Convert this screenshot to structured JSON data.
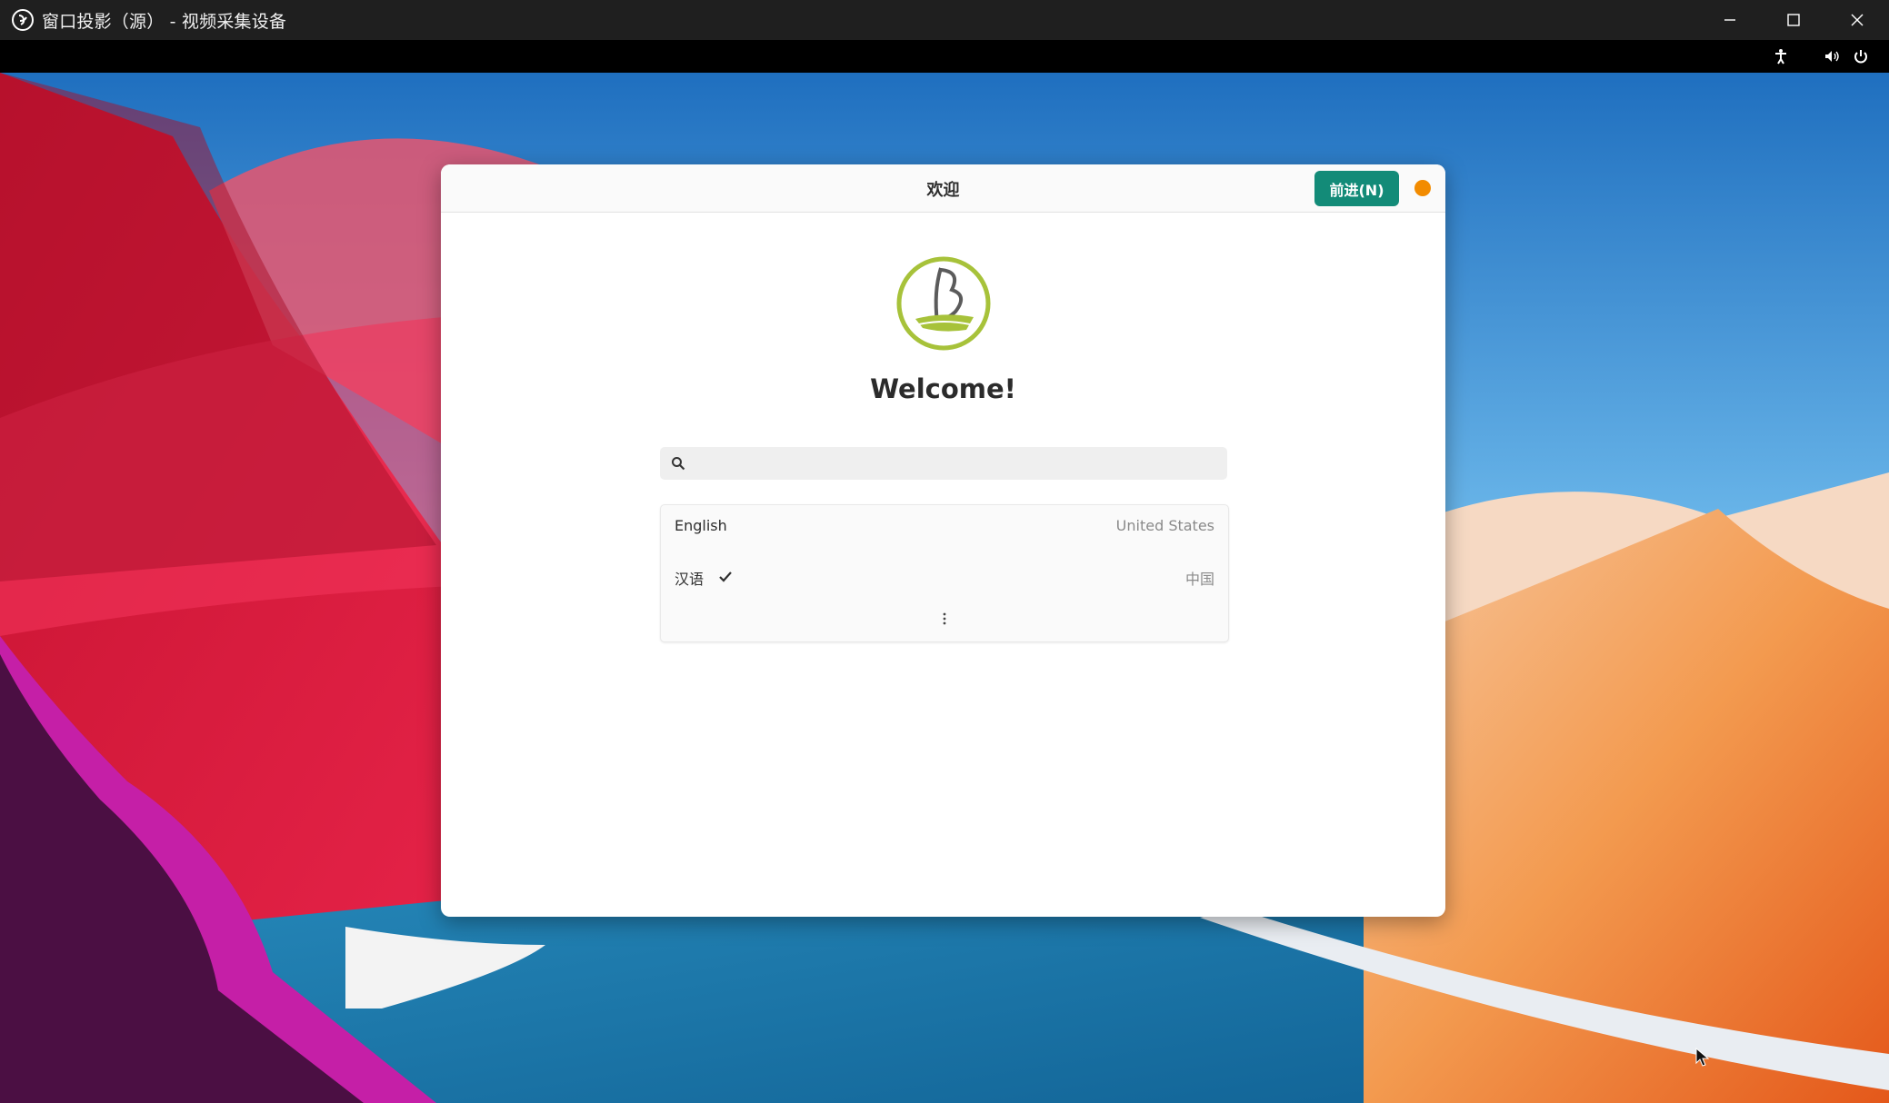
{
  "window": {
    "title": "窗口投影（源） - 视频采集设备",
    "app_icon": "obs-icon",
    "controls": [
      "minimize-icon",
      "maximize-icon",
      "close-icon"
    ]
  },
  "guest_topbar": {
    "icons": [
      "accessibility-icon",
      "volume-icon",
      "power-icon"
    ]
  },
  "dialog": {
    "title": "欢迎",
    "next_button": "前进(N)",
    "status_dot_color": "#f28b00",
    "heading": "Welcome!",
    "search": {
      "placeholder": "",
      "value": ""
    },
    "languages": [
      {
        "name": "English",
        "region": "United States",
        "selected": false
      },
      {
        "name": "汉语",
        "region": "中国",
        "selected": true
      }
    ],
    "more_icon": "more-vertical-icon"
  },
  "colors": {
    "accent": "#138b78",
    "titlebar": "#1f1f1f"
  }
}
